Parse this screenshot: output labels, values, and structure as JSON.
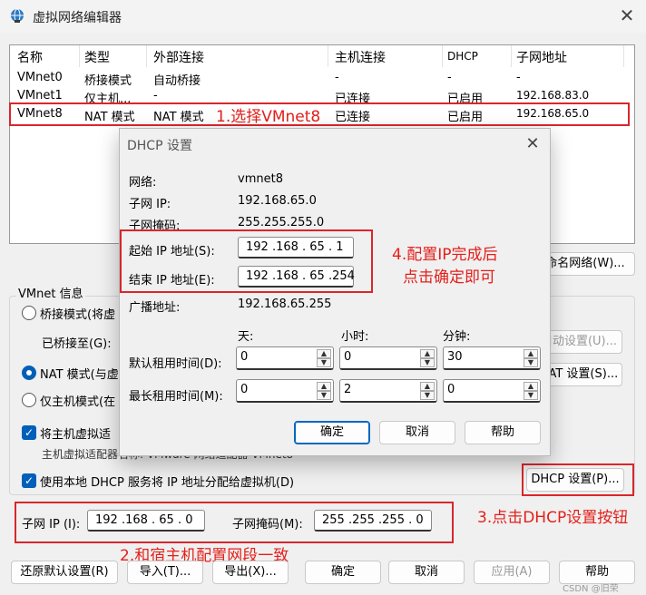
{
  "window": {
    "title": "虚拟网络编辑器",
    "close_glyph": "✕"
  },
  "table": {
    "headers": [
      "名称",
      "类型",
      "外部连接",
      "主机连接",
      "DHCP",
      "子网地址"
    ],
    "rows": [
      [
        "VMnet0",
        "桥接模式",
        "自动桥接",
        "-",
        "-",
        "-"
      ],
      [
        "VMnet1",
        "仅主机...",
        "-",
        "已连接",
        "已启用",
        "192.168.83.0"
      ],
      [
        "VMnet8",
        "NAT 模式",
        "NAT 模式",
        "已连接",
        "已启用",
        "192.168.65.0"
      ]
    ]
  },
  "vmnet_info": {
    "group_label": "VMnet 信息",
    "bridged_label": "桥接模式(将虚",
    "bridged_to_label": "已桥接至(G):",
    "nat_label": "NAT 模式(与虚",
    "hostonly_label": "仅主机模式(在",
    "connect_adapter_label": "将主机虚拟适",
    "adapter_name_label": "主机虚拟适配器名称: VMware 网络适配器 VMnet8",
    "dhcp_label": "使用本地 DHCP 服务将 IP 地址分配给虚拟机(D)",
    "rename_btn": "命名网络(W)...",
    "auto_btn": "自动设置(U)...",
    "nat_settings_btn": "NAT 设置(S)...",
    "dhcp_settings_btn": "DHCP 设置(P)...",
    "subnet_ip_label": "子网 IP (I):",
    "subnet_ip_value": "192 .168 . 65 .  0",
    "subnet_mask_label": "子网掩码(M):",
    "subnet_mask_value": "255 .255 .255 .  0"
  },
  "bottom_buttons": {
    "restore": "还原默认设置(R)",
    "import": "导入(T)...",
    "export": "导出(X)...",
    "ok": "确定",
    "cancel": "取消",
    "apply": "应用(A)",
    "help": "帮助"
  },
  "dhcp_dialog": {
    "title": "DHCP 设置",
    "close_glyph": "✕",
    "network_label": "网络:",
    "network_value": "vmnet8",
    "subnet_ip_label": "子网 IP:",
    "subnet_ip_value": "192.168.65.0",
    "subnet_mask_label": "子网掩码:",
    "subnet_mask_value": "255.255.255.0",
    "start_ip_label": "起始 IP 地址(S):",
    "start_ip_value": "192 .168 . 65 .  1",
    "end_ip_label": "结束 IP 地址(E):",
    "end_ip_value": "192 .168 . 65 .254",
    "broadcast_label": "广播地址:",
    "broadcast_value": "192.168.65.255",
    "col_days": "天:",
    "col_hours": "小时:",
    "col_minutes": "分钟:",
    "default_lease_label": "默认租用时间(D):",
    "default_lease": [
      "0",
      "0",
      "30"
    ],
    "max_lease_label": "最长租用时间(M):",
    "max_lease": [
      "0",
      "2",
      "0"
    ],
    "ok": "确定",
    "cancel": "取消",
    "help": "帮助"
  },
  "annotations": {
    "a1": "1.选择VMnet8",
    "a2": "2.和宿主机配置网段一致",
    "a3": "3.点击DHCP设置按钮",
    "a4_line1": "4.配置IP完成后",
    "a4_line2": "点击确定即可",
    "color": "#e3201b"
  },
  "watermark": "CSDN @旧荣"
}
